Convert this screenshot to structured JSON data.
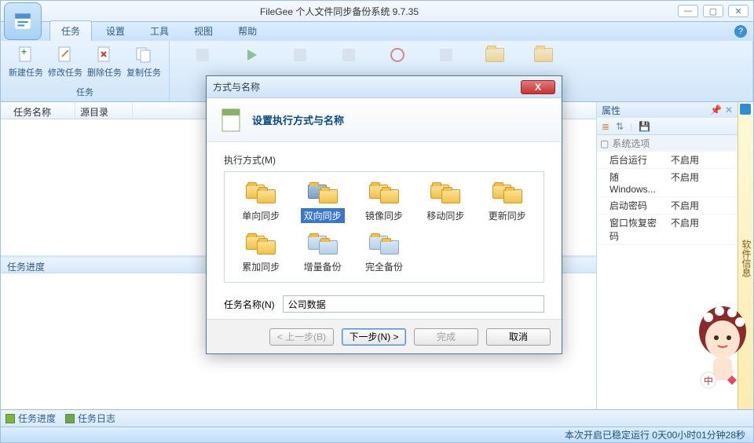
{
  "app": {
    "title": "FileGee 个人文件同步备份系统 9.7.35"
  },
  "menu": {
    "tabs": [
      "任务",
      "设置",
      "工具",
      "视图",
      "帮助"
    ],
    "active": 0
  },
  "ribbon": {
    "group1_name": "任务",
    "btns": [
      "新建任务",
      "修改任务",
      "删除任务",
      "复制任务"
    ]
  },
  "list": {
    "col1": "任务名称",
    "col2": "源目录"
  },
  "progress_pane": "任务进度",
  "properties": {
    "title": "属性",
    "group": "系统选项",
    "rows": [
      {
        "k": "后台运行",
        "v": "不启用"
      },
      {
        "k": "随Windows...",
        "v": "不启用"
      },
      {
        "k": "启动密码",
        "v": "不启用"
      },
      {
        "k": "窗口恢复密码",
        "v": "不启用"
      }
    ]
  },
  "sidetab": "软件信息",
  "bottom": {
    "t1": "任务进度",
    "t2": "任务日志"
  },
  "status": "本次开启已稳定运行 0天00小时01分钟28秒",
  "dialog": {
    "title": "方式与名称",
    "banner": "设置执行方式与名称",
    "method_label": "执行方式(M)",
    "options": [
      "单向同步",
      "双向同步",
      "镜像同步",
      "移动同步",
      "更新同步",
      "累加同步",
      "增量备份",
      "完全备份"
    ],
    "selected": 1,
    "name_label": "任务名称(N)",
    "name_value": "公司数据",
    "btn_prev": "< 上一步(B)",
    "btn_next": "下一步(N) >",
    "btn_finish": "完成",
    "btn_cancel": "取消"
  }
}
